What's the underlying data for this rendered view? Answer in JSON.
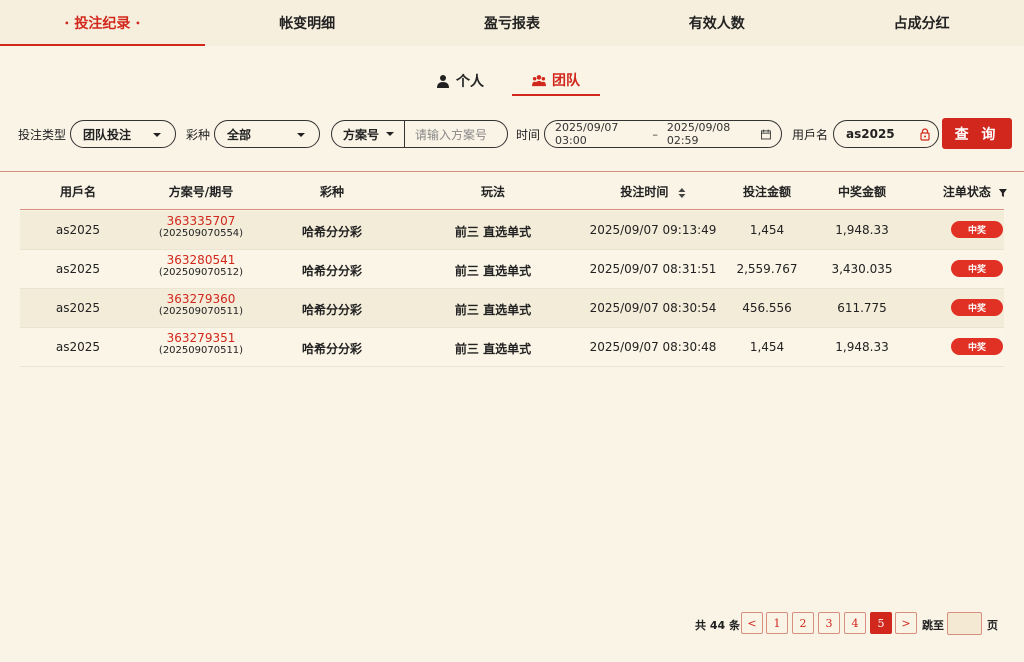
{
  "top_tabs": [
    "投注纪录",
    "帐变明细",
    "盈亏报表",
    "有效人数",
    "占成分红"
  ],
  "sub_tabs": {
    "personal": "个人",
    "team": "团队"
  },
  "filters": {
    "bet_type_label": "投注类型",
    "bet_type_value": "团队投注",
    "lottery_label": "彩种",
    "lottery_value": "全部",
    "plan_select": "方案号",
    "plan_placeholder": "请输入方案号",
    "time_label": "时间",
    "date_start": "2025/09/07 03:00",
    "date_sep": "–",
    "date_end": "2025/09/08 02:59",
    "username_label": "用戶名",
    "username_value": "as2025",
    "query_button": "查 询"
  },
  "table": {
    "headers": [
      "用戶名",
      "方案号/期号",
      "彩种",
      "玩法",
      "投注时间",
      "投注金额",
      "中奖金额",
      "注单状态"
    ],
    "rows": [
      {
        "user": "as2025",
        "plan": "363335707",
        "issue": "(202509070554)",
        "lottery": "哈希分分彩",
        "play": "前三 直选单式",
        "time": "2025/09/07 09:13:49",
        "bet": "1,454",
        "win": "1,948.33",
        "status": "中奖"
      },
      {
        "user": "as2025",
        "plan": "363280541",
        "issue": "(202509070512)",
        "lottery": "哈希分分彩",
        "play": "前三 直选单式",
        "time": "2025/09/07 08:31:51",
        "bet": "2,559.767",
        "win": "3,430.035",
        "status": "中奖"
      },
      {
        "user": "as2025",
        "plan": "363279360",
        "issue": "(202509070511)",
        "lottery": "哈希分分彩",
        "play": "前三 直选单式",
        "time": "2025/09/07 08:30:54",
        "bet": "456.556",
        "win": "611.775",
        "status": "中奖"
      },
      {
        "user": "as2025",
        "plan": "363279351",
        "issue": "(202509070511)",
        "lottery": "哈希分分彩",
        "play": "前三 直选单式",
        "time": "2025/09/07 08:30:48",
        "bet": "1,454",
        "win": "1,948.33",
        "status": "中奖"
      }
    ]
  },
  "pagination": {
    "total_text": "共 44 条",
    "prev": "<",
    "pages": [
      "1",
      "2",
      "3",
      "4",
      "5"
    ],
    "current": "5",
    "next": ">",
    "jump_label": "跳至",
    "page_suffix": "页"
  },
  "colors": {
    "accent": "#d2271c",
    "background": "#faf4e6",
    "status_badge": "#e03124"
  }
}
